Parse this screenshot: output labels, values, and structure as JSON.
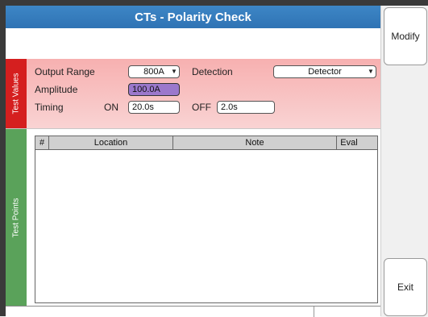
{
  "window": {
    "title": "CTs - Polarity Check"
  },
  "sidebar": {
    "modify_label": "Modify",
    "exit_label": "Exit"
  },
  "test_values": {
    "tab_label": "Test Values",
    "output_range_label": "Output Range",
    "output_range_value": "800A",
    "detection_label": "Detection",
    "detection_value": "Detector",
    "amplitude_label": "Amplitude",
    "amplitude_value": "100.0A",
    "timing_label": "Timing",
    "on_label": "ON",
    "on_value": "20.0s",
    "off_label": "OFF",
    "off_value": "2.0s",
    "dropdown_arrow_icon": "chevron-down-icon",
    "amplitude_color": "#9b78cc"
  },
  "test_points": {
    "tab_label": "Test Points",
    "columns": [
      "#",
      "Location",
      "Note",
      "Eval"
    ]
  },
  "colors": {
    "title_blue": "#2f73b4",
    "test_values_tab": "#d51f1f",
    "test_points_tab": "#5aa25a"
  }
}
